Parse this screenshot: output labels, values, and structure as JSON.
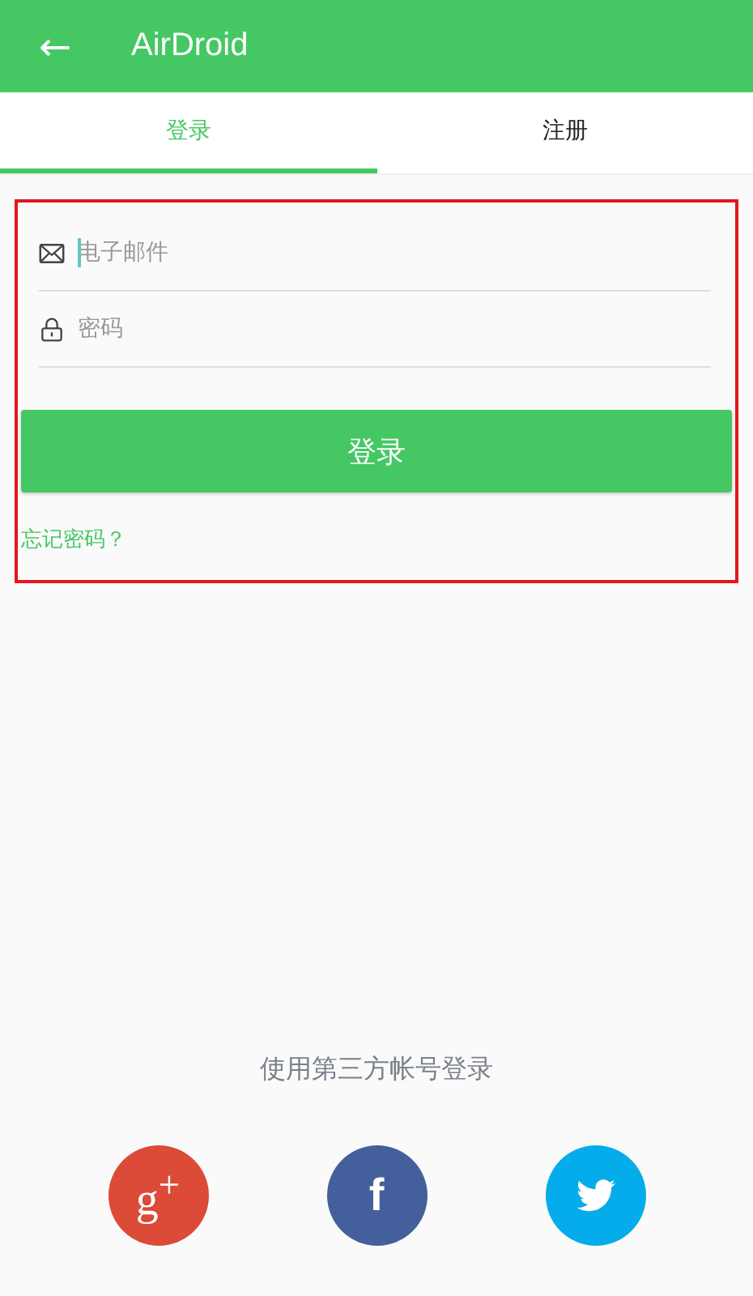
{
  "app_bar": {
    "back_icon": "←",
    "title": "AirDroid"
  },
  "tabs": [
    {
      "label": "登录",
      "selected": true
    },
    {
      "label": "注册",
      "selected": false
    }
  ],
  "login_form": {
    "highlighted": true,
    "fields": [
      {
        "kind": "email",
        "placeholder": "电子邮件",
        "focused": true
      },
      {
        "kind": "password",
        "placeholder": "密码",
        "focused": false
      }
    ],
    "submit_button": "登录",
    "forgot_link": "忘记密码？"
  },
  "third_party": {
    "caption": "使用第三方帐号登录",
    "buttons": [
      {
        "kind": "google",
        "label": "g$^{+}$",
        "color": "#dc4a38"
      },
      {
        "kind": "facebook",
        "label": "f",
        "color": "#44609c"
      },
      {
        "kind": "twitter",
        "color": "#04aceb"
      }
    ]
  }
}
